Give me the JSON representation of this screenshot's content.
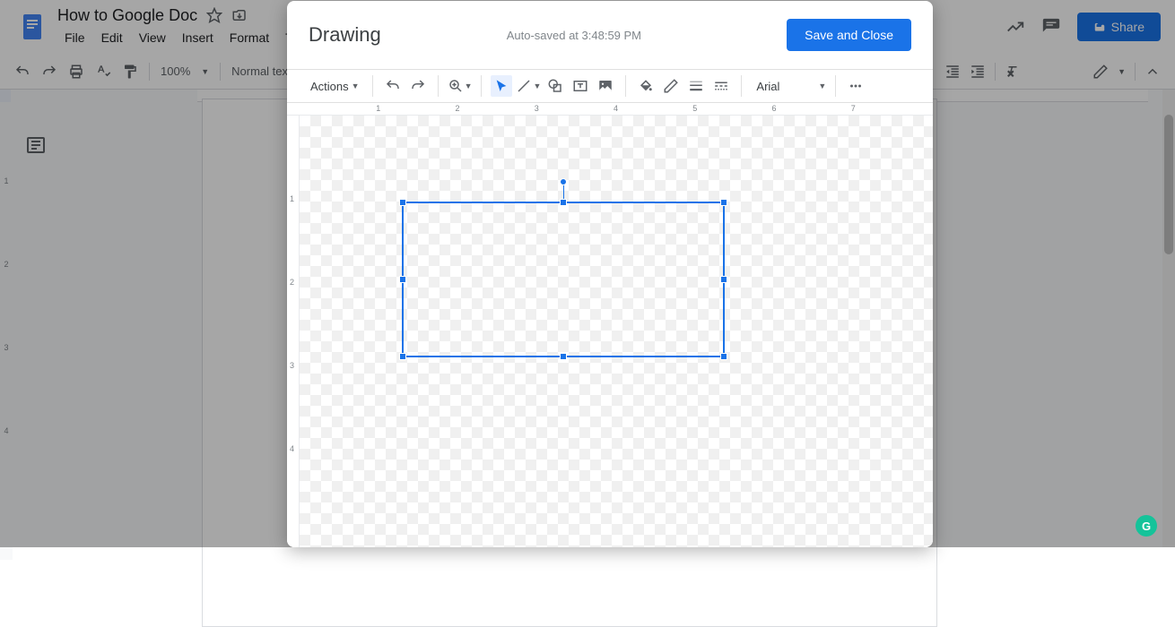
{
  "doc": {
    "title": "How to Google Doc",
    "menu": [
      "File",
      "Edit",
      "View",
      "Insert",
      "Format",
      "Tools"
    ],
    "zoom": "100%",
    "style": "Normal text",
    "share": "Share"
  },
  "drawing": {
    "title": "Drawing",
    "autosave": "Auto-saved at 3:48:59 PM",
    "save_close": "Save and Close",
    "actions": "Actions",
    "font": "Arial",
    "ruler_h": [
      "1",
      "2",
      "3",
      "4",
      "5",
      "6",
      "7"
    ],
    "ruler_v": [
      "1",
      "2",
      "3",
      "4"
    ]
  },
  "doc_ruler_v": [
    "1",
    "2",
    "3",
    "4"
  ],
  "colors": {
    "accent": "#1a73e8"
  }
}
